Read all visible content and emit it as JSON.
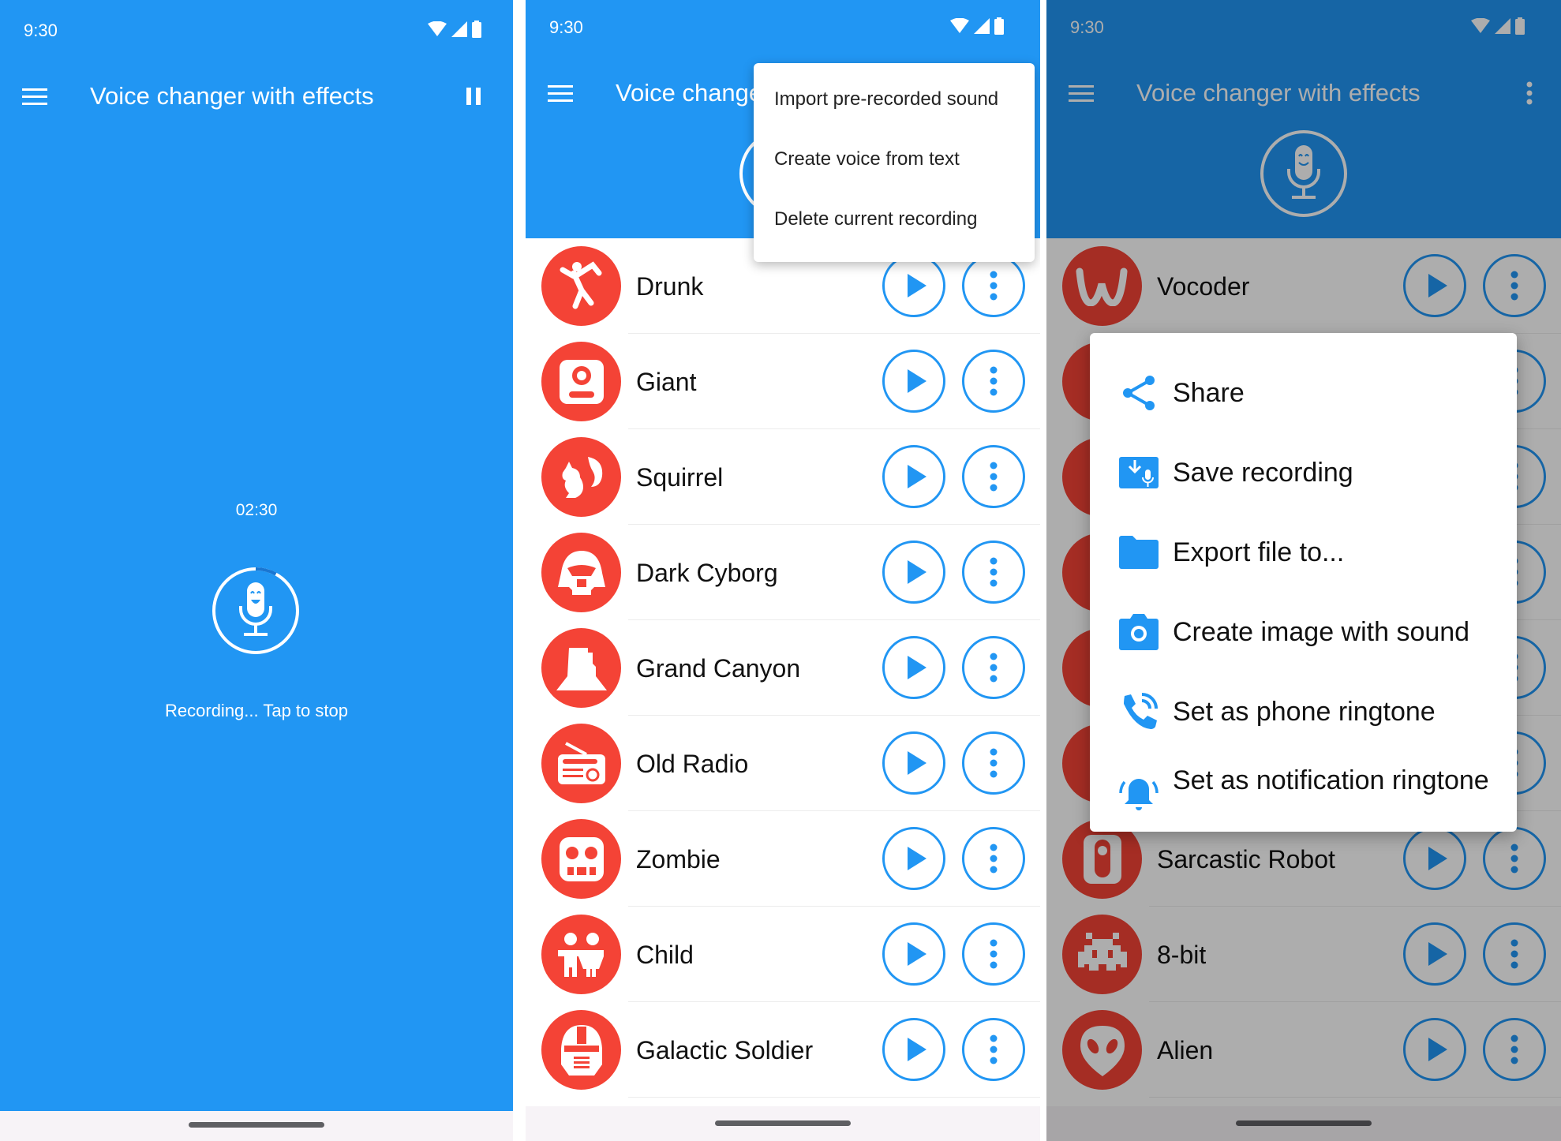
{
  "colors": {
    "primary": "#2196F3",
    "accent_red": "#F44336",
    "nav_bar": "#f7f3f7"
  },
  "status_bar": {
    "time": "9:30",
    "icons": [
      "wifi-icon",
      "signal-icon",
      "battery-icon"
    ]
  },
  "app": {
    "title": "Voice changer with effects",
    "title_truncated": "Voice chang"
  },
  "screen_recording": {
    "timer": "02:30",
    "status_label": "Recording... Tap to stop",
    "progress_fraction": 0.08,
    "action_icon": "pause-icon"
  },
  "screen_effects_list": {
    "overflow_menu": {
      "items": [
        {
          "label": "Import pre-recorded sound"
        },
        {
          "label": "Create voice from text"
        },
        {
          "label": "Delete current recording"
        }
      ]
    },
    "effects": [
      {
        "name": "Drunk",
        "icon": "drunk-person-icon"
      },
      {
        "name": "Giant",
        "icon": "giant-icon"
      },
      {
        "name": "Squirrel",
        "icon": "squirrel-icon"
      },
      {
        "name": "Dark Cyborg",
        "icon": "dark-cyborg-helmet-icon"
      },
      {
        "name": "Grand Canyon",
        "icon": "canyon-rock-icon"
      },
      {
        "name": "Old Radio",
        "icon": "radio-icon"
      },
      {
        "name": "Zombie",
        "icon": "zombie-face-icon"
      },
      {
        "name": "Child",
        "icon": "children-icon"
      },
      {
        "name": "Galactic Soldier",
        "icon": "galactic-soldier-helmet-icon"
      }
    ]
  },
  "screen_share_dialog": {
    "background_effects": [
      {
        "name": "Vocoder",
        "icon": "vocoder-w-icon"
      },
      {
        "name": "",
        "icon": "hidden-effect-icon"
      },
      {
        "name": "",
        "icon": "hidden-effect-icon"
      },
      {
        "name": "",
        "icon": "hidden-effect-icon"
      },
      {
        "name": "",
        "icon": "hidden-effect-icon"
      },
      {
        "name": "",
        "icon": "hidden-effect-icon"
      },
      {
        "name": "Sarcastic Robot",
        "icon": "robot-icon"
      },
      {
        "name": "8-bit",
        "icon": "pixel-invader-icon"
      },
      {
        "name": "Alien",
        "icon": "alien-icon"
      }
    ],
    "dialog_items": [
      {
        "label": "Share",
        "icon": "share-icon"
      },
      {
        "label": "Save recording",
        "icon": "save-recording-icon"
      },
      {
        "label": "Export file to...",
        "icon": "folder-icon"
      },
      {
        "label": "Create image with sound",
        "icon": "camera-icon"
      },
      {
        "label": "Set as phone ringtone",
        "icon": "phone-ringing-icon"
      },
      {
        "label": "Set as notification ringtone",
        "icon": "notification-bell-icon"
      }
    ]
  }
}
